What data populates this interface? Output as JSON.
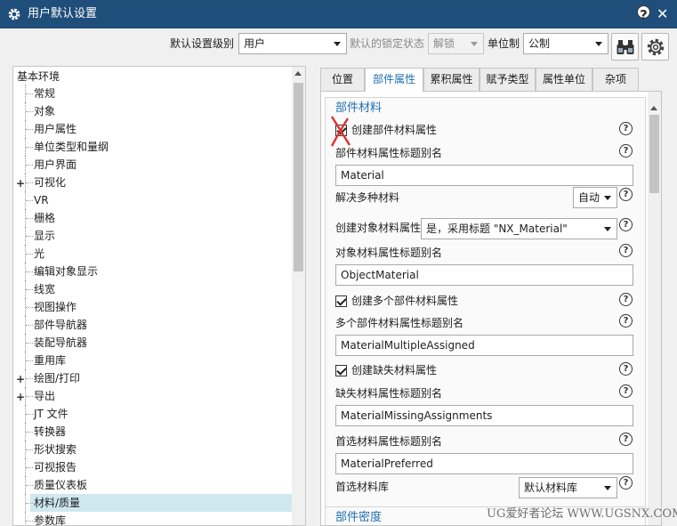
{
  "window": {
    "title": "用户默认设置",
    "help_glyph": "?",
    "close_glyph": "✕"
  },
  "toolbar": {
    "level_label": "默认设置级别",
    "level_value": "用户",
    "lock_label": "默认的锁定状态",
    "lock_value": "解锁",
    "units_label": "单位制",
    "units_value": "公制"
  },
  "tree": {
    "header": "基本环境",
    "items": [
      {
        "label": "常规",
        "expandable": false
      },
      {
        "label": "对象",
        "expandable": false
      },
      {
        "label": "用户属性",
        "expandable": false
      },
      {
        "label": "单位类型和量纲",
        "expandable": false
      },
      {
        "label": "用户界面",
        "expandable": false
      },
      {
        "label": "可视化",
        "expandable": true
      },
      {
        "label": "VR",
        "expandable": false
      },
      {
        "label": "栅格",
        "expandable": false
      },
      {
        "label": "显示",
        "expandable": false
      },
      {
        "label": "光",
        "expandable": false
      },
      {
        "label": "编辑对象显示",
        "expandable": false
      },
      {
        "label": "线宽",
        "expandable": false
      },
      {
        "label": "视图操作",
        "expandable": false
      },
      {
        "label": "部件导航器",
        "expandable": false
      },
      {
        "label": "装配导航器",
        "expandable": false
      },
      {
        "label": "重用库",
        "expandable": false
      },
      {
        "label": "绘图/打印",
        "expandable": true
      },
      {
        "label": "导出",
        "expandable": true
      },
      {
        "label": "JT 文件",
        "expandable": false
      },
      {
        "label": "转换器",
        "expandable": false
      },
      {
        "label": "形状搜索",
        "expandable": false
      },
      {
        "label": "可视报告",
        "expandable": false
      },
      {
        "label": "质量仪表板",
        "expandable": false
      },
      {
        "label": "材料/质量",
        "expandable": false,
        "selected": true
      },
      {
        "label": "参数库",
        "expandable": false
      }
    ]
  },
  "tabs": [
    {
      "label": "位置",
      "active": false
    },
    {
      "label": "部件属性",
      "active": true
    },
    {
      "label": "累积属性",
      "active": false
    },
    {
      "label": "赋予类型",
      "active": false
    },
    {
      "label": "属性单位",
      "active": false
    },
    {
      "label": "杂项",
      "active": false
    }
  ],
  "panel": {
    "group_title": "部件材料",
    "create_part_material_attr": {
      "label": "创建部件材料属性",
      "checked": true
    },
    "part_material_alias_label": "部件材料属性标题别名",
    "part_material_alias_value": "Material",
    "resolve_multi_label": "解决多种材料",
    "resolve_multi_value": "自动",
    "create_object_attr_label": "创建对象材料属性",
    "create_object_attr_value": "是，采用标题 \"NX_Material\"",
    "object_alias_label": "对象材料属性标题别名",
    "object_alias_value": "ObjectMaterial",
    "create_multi_attr": {
      "label": "创建多个部件材料属性",
      "checked": true
    },
    "multi_alias_label": "多个部件材料属性标题别名",
    "multi_alias_value": "MaterialMultipleAssigned",
    "create_missing_attr": {
      "label": "创建缺失材料属性",
      "checked": true
    },
    "missing_alias_label": "缺失材料属性标题别名",
    "missing_alias_value": "MaterialMissingAssignments",
    "preferred_alias_label": "首选材料属性标题别名",
    "preferred_alias_value": "MaterialPreferred",
    "preferred_library_label": "首选材料库",
    "preferred_library_value": "默认材料库",
    "next_group_title": "部件密度",
    "help_glyph": "?"
  },
  "watermark": "UG爱好者论坛 WWW.UGSNX.COM",
  "colors": {
    "titlebar": "#1f4e7a",
    "accent": "#1f6fb2",
    "selected_row": "#cfe8f0",
    "annotation": "#e03030"
  }
}
